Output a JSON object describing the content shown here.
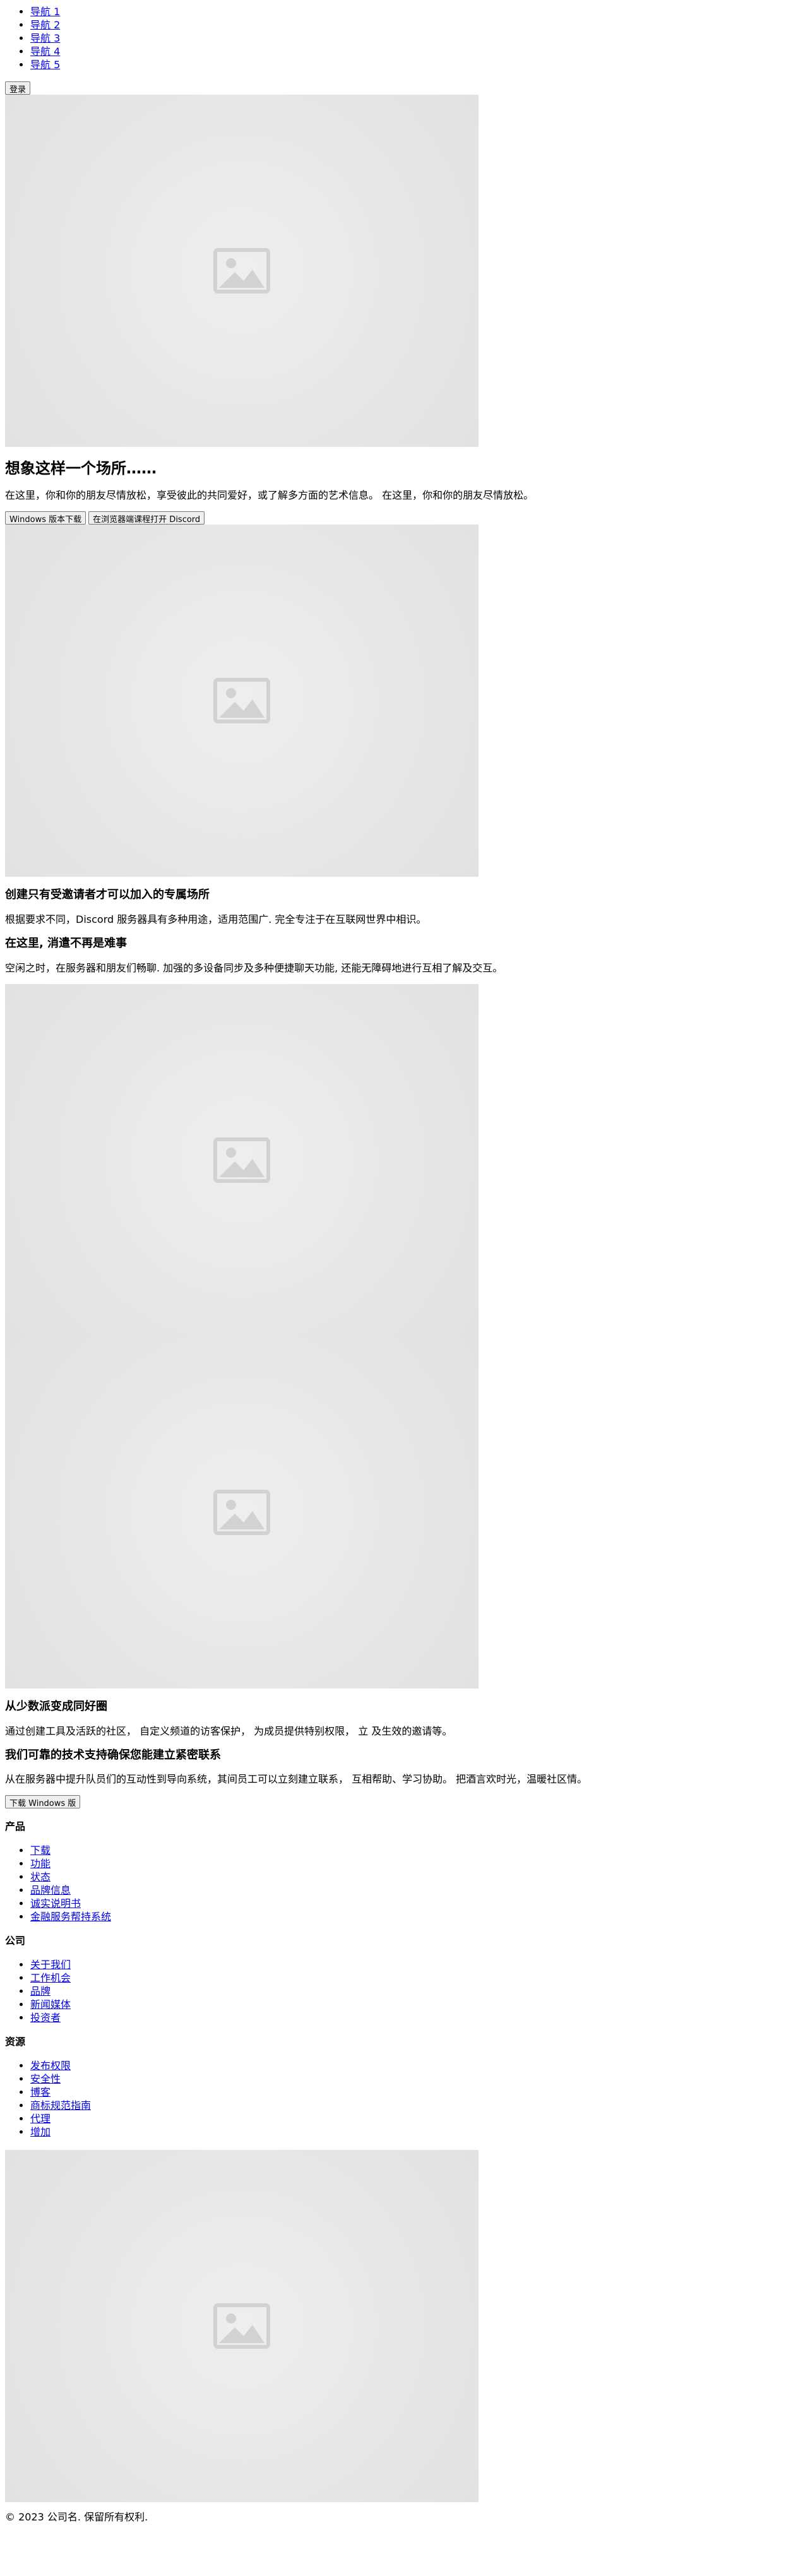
{
  "nav": {
    "items": [
      "导航 1",
      "导航 2",
      "导航 3",
      "导航 4",
      "导航 5"
    ],
    "login_label": "登录"
  },
  "hero": {
    "title": "想象这样一个场所……",
    "description": "在这里，你和你的朋友尽情放松，享受彼此的共同爱好，或了解多方面的艺术信息。 在这里，你和你的朋友尽情放松。",
    "buttons": {
      "windows_download": "Windows 版本下载",
      "open_in_browser": "在浏览器端课程打开 Discord"
    }
  },
  "section_invite": {
    "title": "创建只有受邀请者才可以加入的专属场所",
    "description": "根据要求不同，Discord 服务器具有多种用途，适用范围广. 完全专注于在互联网世界中相识。"
  },
  "section_easy": {
    "title": "在这里, 消遣不再是难事",
    "description": "空闲之时，在服务器和朋友们畅聊. 加强的多设备同步及多种便捷聊天功能, 还能无障碍地进行互相了解及交互。"
  },
  "section_community": {
    "title": "从少数派变成同好圈",
    "description": "通过创建工具及活跃的社区， 自定义频道的访客保护， 为成员提供特别权限， 立 及生效的邀请等。"
  },
  "section_tech": {
    "title": "我们可靠的技术支持确保您能建立紧密联系",
    "description": "从在服务器中提升队员们的互动性到导向系统，其间员工可以立刻建立联系， 互相帮助、学习协助。 把酒言欢时光，温暖社区情。",
    "download_label": "下载 Windows 版"
  },
  "footer": {
    "product": {
      "title": "产品",
      "links": [
        "下载",
        "功能",
        "状态",
        "品牌信息",
        "诚实说明书",
        "金融服务帮持系统"
      ]
    },
    "company": {
      "title": "公司",
      "links": [
        "关于我们",
        "工作机会",
        "品牌",
        "新闻媒体",
        "投资者"
      ]
    },
    "resources": {
      "title": "资源",
      "links": [
        "发布权限",
        "安全性",
        "博客",
        "商标规范指南",
        "代理",
        "增加"
      ]
    },
    "copyright": "© 2023 公司名. 保留所有权利."
  },
  "icons": {
    "image_placeholder": "image-placeholder-icon"
  },
  "colors": {
    "link": "#0000ee",
    "placeholder_bg": "#e6e6e6",
    "placeholder_icon": "#d2d2d2"
  }
}
